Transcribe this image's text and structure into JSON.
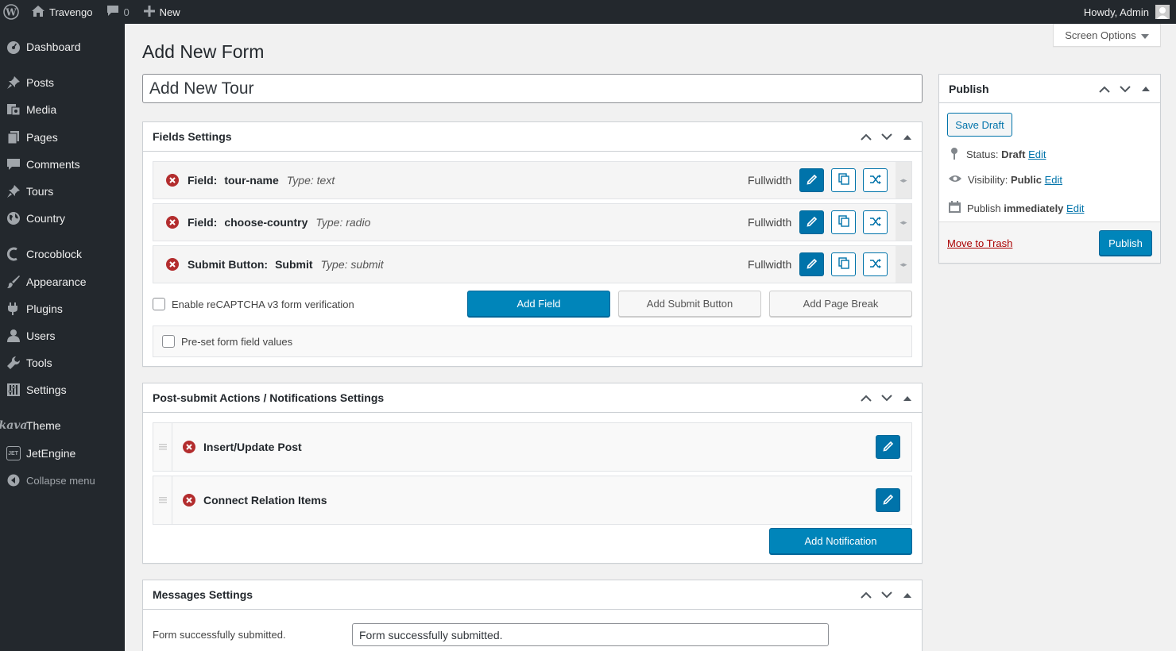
{
  "adminbar": {
    "site_name": "Travengo",
    "comments_count": "0",
    "new_label": "New",
    "howdy": "Howdy, Admin"
  },
  "sidebar": {
    "items": [
      {
        "label": "Dashboard",
        "icon": "dashboard-icon"
      },
      {
        "label": "Posts",
        "icon": "pin-icon"
      },
      {
        "label": "Media",
        "icon": "media-icon"
      },
      {
        "label": "Pages",
        "icon": "pages-icon"
      },
      {
        "label": "Comments",
        "icon": "comment-icon"
      },
      {
        "label": "Tours",
        "icon": "pin-icon"
      },
      {
        "label": "Country",
        "icon": "globe-icon"
      },
      {
        "label": "Crocoblock",
        "icon": "crocoblock-icon"
      },
      {
        "label": "Appearance",
        "icon": "brush-icon"
      },
      {
        "label": "Plugins",
        "icon": "plugin-icon"
      },
      {
        "label": "Users",
        "icon": "user-icon"
      },
      {
        "label": "Tools",
        "icon": "wrench-icon"
      },
      {
        "label": "Settings",
        "icon": "settings-icon"
      },
      {
        "label": "Theme",
        "icon": "kava-logo",
        "logo_text": "kava"
      },
      {
        "label": "JetEngine",
        "icon": "jetengine-icon",
        "logo_text": "JET"
      },
      {
        "label": "Collapse menu",
        "icon": "collapse-icon"
      }
    ]
  },
  "header": {
    "title": "Add New Form",
    "screen_options": "Screen Options"
  },
  "form": {
    "title_value": "Add New Tour"
  },
  "fields_settings": {
    "title": "Fields Settings",
    "fields": [
      {
        "prefix": "Field:",
        "name": "tour-name",
        "type": "Type: text",
        "width": "Fullwidth"
      },
      {
        "prefix": "Field:",
        "name": "choose-country",
        "type": "Type: radio",
        "width": "Fullwidth"
      },
      {
        "prefix": "Submit Button:",
        "name": "Submit",
        "type": "Type: submit",
        "width": "Fullwidth"
      }
    ],
    "recaptcha_label": "Enable reCAPTCHA v3 form verification",
    "add_field": "Add Field",
    "add_submit": "Add Submit Button",
    "add_page_break": "Add Page Break",
    "preset_label": "Pre-set form field values"
  },
  "notifications": {
    "title": "Post-submit Actions / Notifications Settings",
    "items": [
      {
        "label": "Insert/Update Post"
      },
      {
        "label": "Connect Relation Items"
      }
    ],
    "add_notification": "Add Notification"
  },
  "messages": {
    "title": "Messages Settings",
    "success_label": "Form successfully submitted.",
    "success_value": "Form successfully submitted."
  },
  "publish": {
    "title": "Publish",
    "save_draft": "Save Draft",
    "status_label": "Status:",
    "status_value": "Draft",
    "visibility_label": "Visibility:",
    "visibility_value": "Public",
    "publish_label": "Publish",
    "publish_value": "immediately",
    "edit": "Edit",
    "move_to_trash": "Move to Trash",
    "publish_button": "Publish"
  },
  "colors": {
    "admin_dark": "#23282d",
    "primary": "#0085ba",
    "link": "#0073aa",
    "danger": "#a00"
  }
}
